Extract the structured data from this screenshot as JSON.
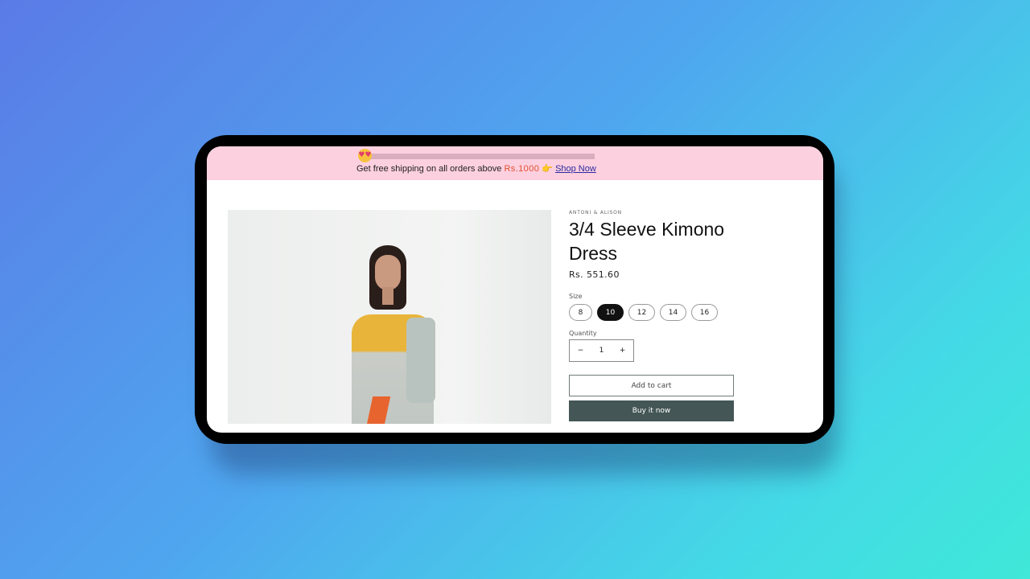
{
  "banner": {
    "text": "Get free shipping on all orders above ",
    "price": "Rs.1000",
    "pointer": "👉",
    "link": "Shop Now",
    "emoji": "😍"
  },
  "product": {
    "vendor": "ANTONI & ALISON",
    "title": "3/4 Sleeve Kimono Dress",
    "price": "Rs. 551.60",
    "size_label": "Size",
    "sizes": [
      "8",
      "10",
      "12",
      "14",
      "16"
    ],
    "selected_size": "10",
    "quantity_label": "Quantity",
    "quantity": "1",
    "minus": "−",
    "plus": "+",
    "add_to_cart": "Add to cart",
    "buy_now": "Buy it now"
  },
  "colors": {
    "banner": "#fdd0df",
    "buy_button": "#445656",
    "accent_price": "#e0502f"
  }
}
